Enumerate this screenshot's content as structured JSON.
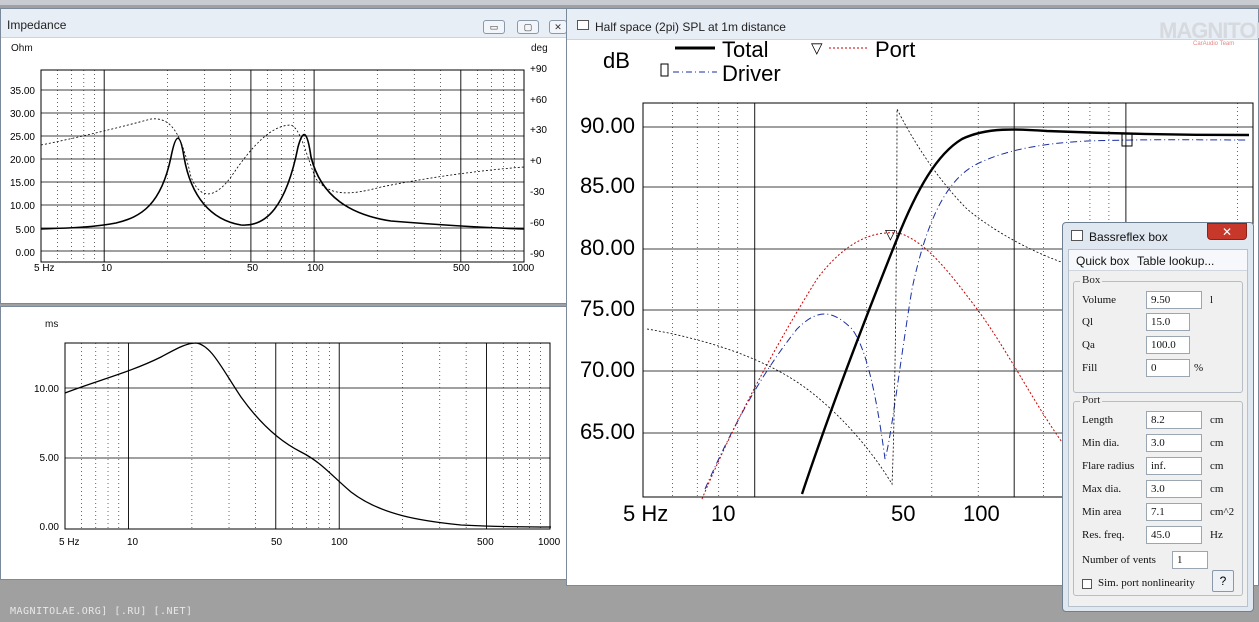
{
  "impedance_window": {
    "title": "Impedance",
    "left_unit": "Ohm",
    "right_unit": "deg",
    "y_ticks": [
      "35.00",
      "30.00",
      "25.00",
      "20.00",
      "15.00",
      "10.00",
      "5.00",
      "0.00"
    ],
    "phase_ticks": [
      "+90",
      "+60",
      "+30",
      "+0",
      "-30",
      "-60",
      "-90"
    ],
    "x_ticks": [
      "5 Hz",
      "10",
      "50",
      "100",
      "500",
      "1000"
    ],
    "btn_min": "▭",
    "btn_max": "▢",
    "btn_close": "✕"
  },
  "delay_window": {
    "unit": "ms",
    "y_ticks": [
      "10.00",
      "5.00",
      "0.00"
    ],
    "x_ticks": [
      "5 Hz",
      "10",
      "50",
      "100",
      "500",
      "1000"
    ]
  },
  "spl_window": {
    "title": "Half space (2pi) SPL at 1m distance",
    "y_unit": "dB",
    "legend": {
      "total": "Total",
      "port": "Port",
      "driver": "Driver"
    },
    "y_ticks": [
      "90.00",
      "85.00",
      "80.00",
      "75.00",
      "70.00",
      "65.00"
    ],
    "x_ticks": [
      "5 Hz",
      "10",
      "50",
      "100"
    ]
  },
  "dialog": {
    "title": "Bassreflex box",
    "close": "✕",
    "menu": [
      "Quick box",
      "Table lookup..."
    ],
    "box_group": "Box",
    "box_fields": [
      {
        "label": "Volume",
        "value": "9.50",
        "unit": "l"
      },
      {
        "label": "Ql",
        "value": "15.0",
        "unit": ""
      },
      {
        "label": "Qa",
        "value": "100.0",
        "unit": ""
      },
      {
        "label": "Fill",
        "value": "0",
        "unit": "%"
      }
    ],
    "port_group": "Port",
    "port_fields": [
      {
        "label": "Length",
        "value": "8.2",
        "unit": "cm"
      },
      {
        "label": "Min dia.",
        "value": "3.0",
        "unit": "cm"
      },
      {
        "label": "Flare radius",
        "value": "inf.",
        "unit": "cm"
      },
      {
        "label": "Max dia.",
        "value": "3.0",
        "unit": "cm"
      },
      {
        "label": "Min area",
        "value": "7.1",
        "unit": "cm^2"
      },
      {
        "label": "Res. freq.",
        "value": "45.0",
        "unit": "Hz"
      }
    ],
    "vents_label": "Number of vents",
    "vents_value": "1",
    "sim_label": "Sim. port nonlinearity",
    "help_button": "?"
  },
  "status_text": "MAGNITOLAE.ORG] [.RU] [.NET]",
  "watermark": {
    "main": "MAGNITOLA",
    "sub": "CarAudio Team"
  }
}
